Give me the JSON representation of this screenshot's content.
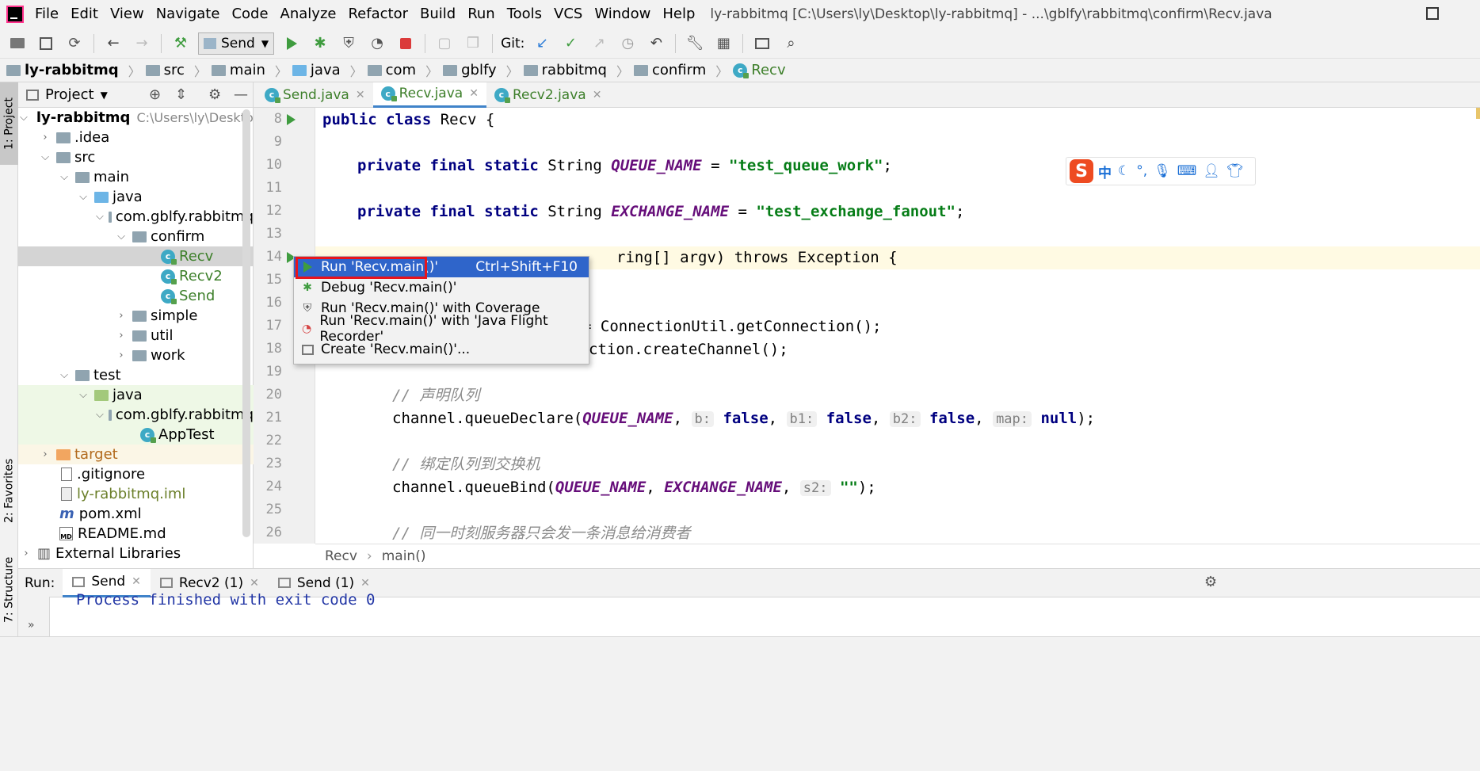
{
  "window": {
    "title": "ly-rabbitmq [C:\\Users\\ly\\Desktop\\ly-rabbitmq] - ...\\gblfy\\rabbitmq\\confirm\\Recv.java"
  },
  "menu": [
    "File",
    "Edit",
    "View",
    "Navigate",
    "Code",
    "Analyze",
    "Refactor",
    "Build",
    "Run",
    "Tools",
    "VCS",
    "Window",
    "Help"
  ],
  "toolbar": {
    "run_config": "Send",
    "git_label": "Git:"
  },
  "breadcrumb": [
    "ly-rabbitmq",
    "src",
    "main",
    "java",
    "com",
    "gblfy",
    "rabbitmq",
    "confirm",
    "Recv"
  ],
  "side_tabs": {
    "project": "1: Project",
    "favorites": "2: Favorites",
    "structure": "7: Structure"
  },
  "project_panel": {
    "title": "Project",
    "tree": [
      {
        "label": "ly-rabbitmq",
        "extra": "C:\\Users\\ly\\Desktop\\",
        "arrow": "open"
      },
      {
        "label": ".idea",
        "arrow": "closed"
      },
      {
        "label": "src",
        "arrow": "open"
      },
      {
        "label": "main",
        "arrow": "open"
      },
      {
        "label": "java",
        "arrow": "open"
      },
      {
        "label": "com.gblfy.rabbitmq",
        "arrow": "open"
      },
      {
        "label": "confirm",
        "arrow": "open"
      },
      {
        "label": "Recv",
        "arrow": ""
      },
      {
        "label": "Recv2",
        "arrow": ""
      },
      {
        "label": "Send",
        "arrow": ""
      },
      {
        "label": "simple",
        "arrow": "closed"
      },
      {
        "label": "util",
        "arrow": "closed"
      },
      {
        "label": "work",
        "arrow": "closed"
      },
      {
        "label": "test",
        "arrow": "open"
      },
      {
        "label": "java",
        "arrow": "open"
      },
      {
        "label": "com.gblfy.rabbitmq",
        "arrow": "open"
      },
      {
        "label": "AppTest",
        "arrow": ""
      },
      {
        "label": "target",
        "arrow": "closed"
      },
      {
        "label": ".gitignore",
        "arrow": ""
      },
      {
        "label": "ly-rabbitmq.iml",
        "arrow": ""
      },
      {
        "label": "pom.xml",
        "arrow": ""
      },
      {
        "label": "README.md",
        "arrow": ""
      },
      {
        "label": "External Libraries",
        "arrow": "closed"
      }
    ]
  },
  "editor_tabs": [
    {
      "label": "Send.java"
    },
    {
      "label": "Recv.java"
    },
    {
      "label": "Recv2.java"
    }
  ],
  "line_numbers": [
    "8",
    "9",
    "10",
    "11",
    "12",
    "13",
    "14",
    "15",
    "16",
    "17",
    "18",
    "19",
    "20",
    "21",
    "22",
    "23",
    "24",
    "25",
    "26"
  ],
  "code": {
    "l8_kw": "public class",
    "l8_rest": " Recv {",
    "l10_kw": "private final static",
    "l10_type": " String ",
    "l10_fld": "QUEUE_NAME",
    "l10_eq": " = ",
    "l10_str": "\"test_queue_work\"",
    "l10_end": ";",
    "l12_kw": "private final static",
    "l12_type": " String ",
    "l12_fld": "EXCHANGE_NAME",
    "l12_eq": " = ",
    "l12_str": "\"test_exchange_fanout\"",
    "l12_end": ";",
    "l14_tail": "ring[] argv) throws Exception {",
    "l17_tail": "= ConnectionUtil.getConnection();",
    "l18_tail": "ction.createChannel();",
    "l20_cmt": "// 声明队列",
    "l21_a": "channel.queueDeclare(",
    "l21_fld": "QUEUE_NAME",
    "l21_h1": "b:",
    "l21_h2": "b1:",
    "l21_h3": "b2:",
    "l21_h4": "map:",
    "l21_false": "false",
    "l21_null": "null",
    "l21_end": ");",
    "l23_cmt": "// 绑定队列到交换机",
    "l24_a": "channel.queueBind(",
    "l24_f1": "QUEUE_NAME",
    "l24_f2": "EXCHANGE_NAME",
    "l24_h": "s2:",
    "l24_str": "\"\"",
    "l24_end": ");",
    "l26_cmt": "// 同一时刻服务器只会发一条消息给消费者"
  },
  "context_menu": {
    "items": [
      {
        "label": "Run 'Recv.main()'",
        "shortcut": "Ctrl+Shift+F10"
      },
      {
        "label": "Debug 'Recv.main()'",
        "shortcut": ""
      },
      {
        "label": "Run 'Recv.main()' with Coverage",
        "shortcut": ""
      },
      {
        "label": "Run 'Recv.main()' with 'Java Flight Recorder'",
        "shortcut": ""
      },
      {
        "label": "Create 'Recv.main()'...",
        "shortcut": ""
      }
    ]
  },
  "editor_breadcrumb": [
    "Recv",
    "main()"
  ],
  "run_panel": {
    "label": "Run:",
    "tabs": [
      {
        "label": "Send"
      },
      {
        "label": "Recv2 (1)"
      },
      {
        "label": "Send (1)"
      }
    ],
    "output": "Process finished with exit code 0"
  },
  "colors": {
    "accent": "#2f65ca",
    "highlight_box": "#e8141c",
    "run_green": "#3f9c3f"
  }
}
